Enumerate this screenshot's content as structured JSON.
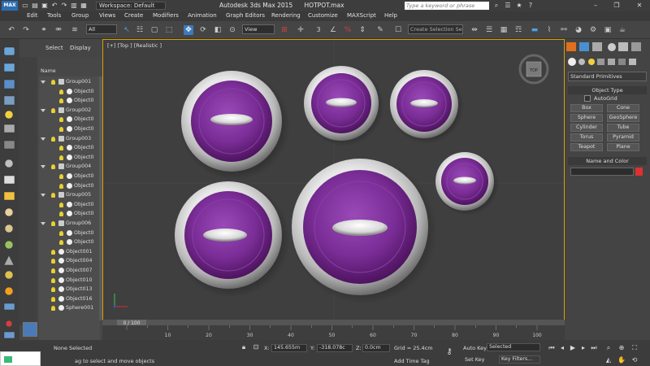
{
  "titlebar": {
    "logo": "MAX",
    "workspace": "Workspace: Default",
    "app_title": "Autodesk 3ds Max  2015",
    "file_name": "HOTPOT.max",
    "search_placeholder": "Type a keyword or phrase"
  },
  "menu": [
    "Edit",
    "Tools",
    "Group",
    "Views",
    "Create",
    "Modifiers",
    "Animation",
    "Graph Editors",
    "Rendering",
    "Customize",
    "MAXScript",
    "Help"
  ],
  "toolbar": {
    "filter_value": "All",
    "view_value": "View",
    "selection_set_placeholder": "Create Selection Se",
    "count_3": "3"
  },
  "explorer": {
    "tab_select": "Select",
    "tab_display": "Display",
    "col_name": "Name",
    "rows": [
      {
        "label": "Group001",
        "kind": "group",
        "indent": 0
      },
      {
        "label": "Object0",
        "kind": "obj",
        "indent": 1
      },
      {
        "label": "Object0",
        "kind": "obj",
        "indent": 1
      },
      {
        "label": "Group002",
        "kind": "group",
        "indent": 0
      },
      {
        "label": "Object0",
        "kind": "obj",
        "indent": 1
      },
      {
        "label": "Object0",
        "kind": "obj",
        "indent": 1
      },
      {
        "label": "Group003",
        "kind": "group",
        "indent": 0
      },
      {
        "label": "Object0",
        "kind": "obj",
        "indent": 1
      },
      {
        "label": "Object0",
        "kind": "obj",
        "indent": 1
      },
      {
        "label": "Group004",
        "kind": "group",
        "indent": 0
      },
      {
        "label": "Object0",
        "kind": "obj",
        "indent": 1
      },
      {
        "label": "Object0",
        "kind": "obj",
        "indent": 1
      },
      {
        "label": "Group005",
        "kind": "group",
        "indent": 0
      },
      {
        "label": "Object0",
        "kind": "obj",
        "indent": 1
      },
      {
        "label": "Object0",
        "kind": "obj",
        "indent": 1
      },
      {
        "label": "Group006",
        "kind": "group",
        "indent": 0
      },
      {
        "label": "Object0",
        "kind": "obj",
        "indent": 1
      },
      {
        "label": "Object0",
        "kind": "obj",
        "indent": 1
      },
      {
        "label": "Object001",
        "kind": "obj",
        "indent": 0
      },
      {
        "label": "Object004",
        "kind": "obj",
        "indent": 0
      },
      {
        "label": "Object007",
        "kind": "obj",
        "indent": 0
      },
      {
        "label": "Object010",
        "kind": "obj",
        "indent": 0
      },
      {
        "label": "Object013",
        "kind": "obj",
        "indent": 0
      },
      {
        "label": "Object016",
        "kind": "obj",
        "indent": 0
      },
      {
        "label": "Sphere001",
        "kind": "obj",
        "indent": 0
      }
    ]
  },
  "viewport": {
    "label": "[+] [Top ] [Realistic ]",
    "viewcube_label": "TOP"
  },
  "command_panel": {
    "dropdown": "Standard Primitives",
    "object_type_header": "Object Type",
    "autogrid": "AutoGrid",
    "buttons": [
      "Box",
      "Cone",
      "Sphere",
      "GeoSphere",
      "Cylinder",
      "Tube",
      "Torus",
      "Pyramid",
      "Teapot",
      "Plane"
    ],
    "name_color_header": "Name and Color"
  },
  "timeline": {
    "slider_label": "0 / 100",
    "ticks": [
      "10",
      "20",
      "30",
      "40",
      "50",
      "60",
      "70",
      "80",
      "90",
      "100"
    ]
  },
  "status": {
    "selection": "None Selected",
    "prompt": "ag to select and move objects",
    "x_label": "X:",
    "x_value": "145.655m",
    "y_label": "Y:",
    "y_value": "-318.078c",
    "z_label": "Z:",
    "z_value": "0.0cm",
    "grid": "Grid = 25.4cm",
    "add_time_tag": "Add Time Tag",
    "auto_key": "Auto Key",
    "selected": "Selected",
    "set_key": "Set Key",
    "key_filters": "Key Filters..."
  },
  "colors": {
    "accent_blue": "#3c79c0",
    "viewport_border": "#d8a000",
    "pot_purple": "#7a2d96",
    "color_swatch": "#e03030"
  }
}
